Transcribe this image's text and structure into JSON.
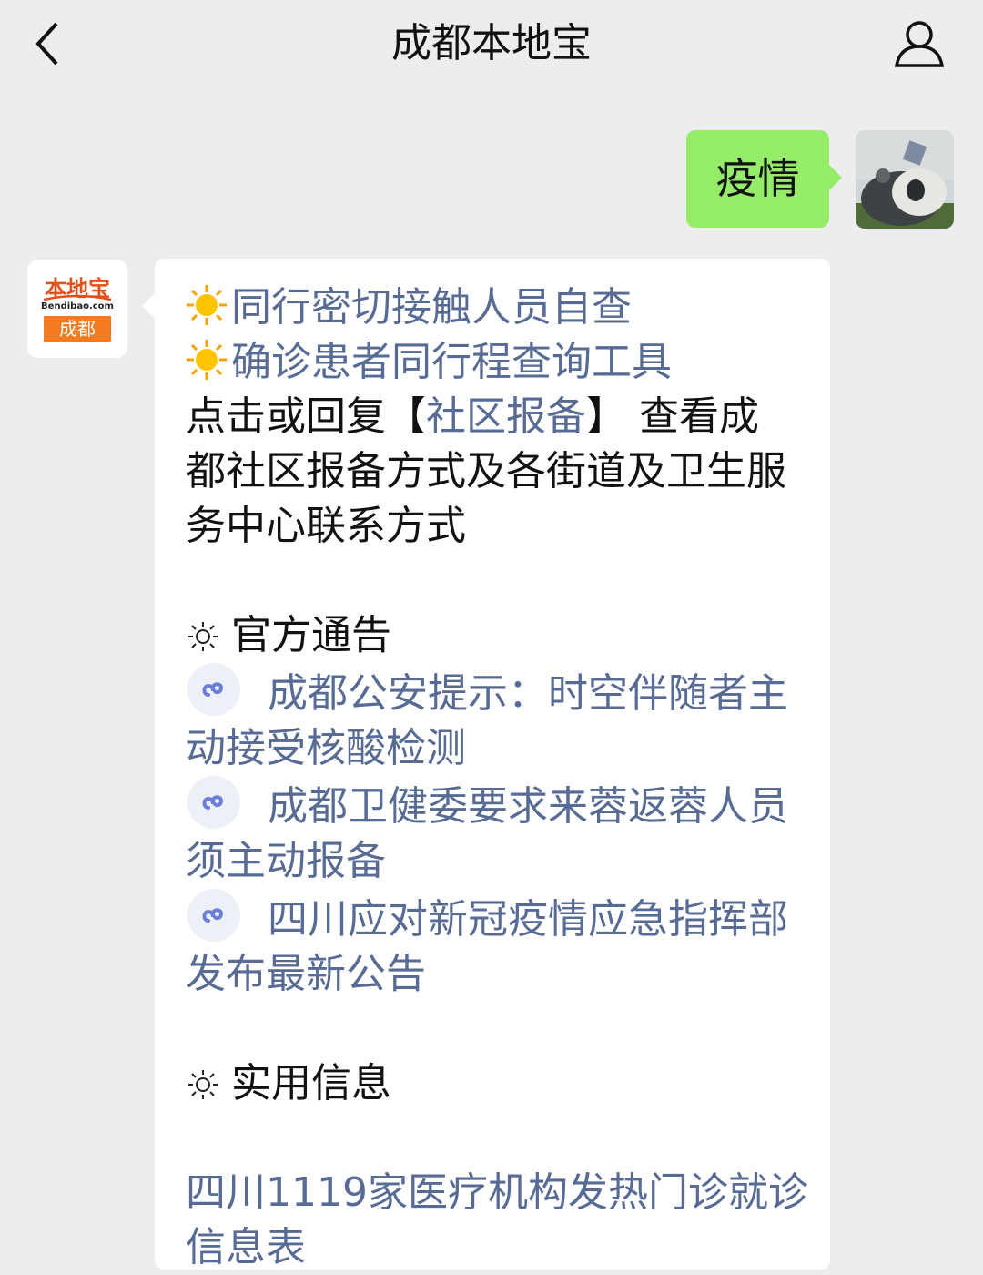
{
  "header": {
    "title": "成都本地宝",
    "back_icon": "chevron-left-icon",
    "profile_icon": "user-icon"
  },
  "outgoing": {
    "text": "疫情",
    "bubble_color": "#95ec69"
  },
  "incoming": {
    "avatar": {
      "logo_top": "本地宝",
      "logo_domain": "Bendibao.com",
      "logo_city": "成都"
    },
    "items": [
      {
        "icon": "sun-icon",
        "text": "同行密切接触人员自查",
        "link": true
      },
      {
        "icon": "sun-icon",
        "text": "确诊患者同行程查询工具",
        "link": true
      }
    ],
    "community": {
      "prefix": "点击或回复",
      "bracket_open": "【",
      "link": "社区报备",
      "bracket_close": "】",
      "suffix_1": " 查看成",
      "line2": "都社区报备方式及各街道及卫生服",
      "line3": "务中心联系方式"
    },
    "section_notices": {
      "heading": "官方通告",
      "items": [
        {
          "line1": "成都公安提示：时空伴随者主",
          "line2": "动接受核酸检测"
        },
        {
          "line1": "成都卫健委要求来蓉返蓉人员",
          "line2": "须主动报备"
        },
        {
          "line1": "四川应对新冠疫情应急指挥部",
          "line2": "发布最新公告"
        }
      ]
    },
    "section_info": {
      "heading": "实用信息",
      "item_line1": "四川1119家医疗机构发热门诊就诊",
      "item_line2": "信息表"
    },
    "link_color": "#576b95"
  }
}
